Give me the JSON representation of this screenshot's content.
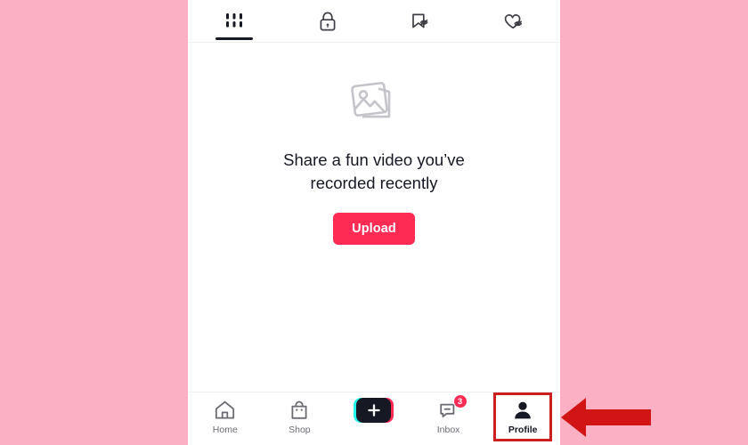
{
  "annotation": {
    "background_color": "#fcb0c3",
    "highlight_color": "#cc1f1f",
    "arrow_color": "#d11515",
    "arrow_direction": "left",
    "highlight_target": "Profile"
  },
  "theme": {
    "accent_red": "#fe2c55",
    "accent_cyan": "#25f4ee",
    "text_primary": "#161823",
    "text_secondary": "#6b6b73"
  },
  "profile_tabs": {
    "active_index": 0,
    "items": [
      {
        "icon": "grid-icon",
        "label": "Videos",
        "active": true
      },
      {
        "icon": "lock-icon",
        "label": "Private",
        "active": false
      },
      {
        "icon": "bookmark-hidden-icon",
        "label": "Favorites",
        "active": false
      },
      {
        "icon": "heart-hidden-icon",
        "label": "Liked",
        "active": false
      }
    ]
  },
  "empty_state": {
    "icon": "photo-stack-icon",
    "message": "Share a fun video you’ve recorded recently",
    "button_label": "Upload"
  },
  "bottom_nav": {
    "active": "Profile",
    "items": [
      {
        "icon": "home-icon",
        "label": "Home",
        "badge": "",
        "active": false
      },
      {
        "icon": "shop-bag-icon",
        "label": "Shop",
        "badge": "",
        "active": false
      },
      {
        "icon": "plus-icon",
        "label": "",
        "badge": "",
        "active": false
      },
      {
        "icon": "inbox-icon",
        "label": "Inbox",
        "badge": "3",
        "active": false
      },
      {
        "icon": "profile-person-icon",
        "label": "Profile",
        "badge": "",
        "active": true
      }
    ]
  }
}
